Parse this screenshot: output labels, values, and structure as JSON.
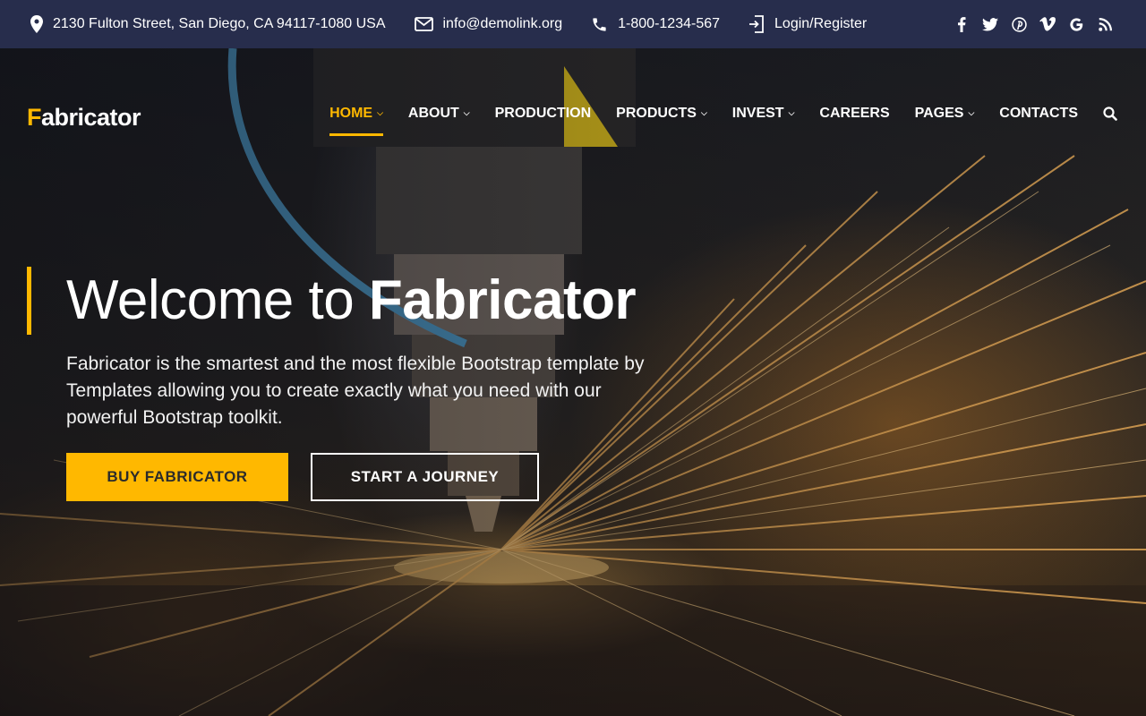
{
  "topbar": {
    "address": "2130 Fulton Street, San Diego, CA 94117-1080 USA",
    "email": "info@demolink.org",
    "phone": "1-800-1234-567",
    "login": "Login/Register",
    "socials": [
      "facebook-icon",
      "twitter-icon",
      "pinterest-icon",
      "vimeo-icon",
      "google-icon",
      "rss-icon"
    ]
  },
  "brand": {
    "logo_first": "F",
    "logo_rest": "abricator"
  },
  "nav": {
    "items": [
      {
        "label": "HOME",
        "active": true,
        "dropdown": true
      },
      {
        "label": "ABOUT",
        "dropdown": true
      },
      {
        "label": "PRODUCTION",
        "dropdown": false
      },
      {
        "label": "PRODUCTS",
        "dropdown": true
      },
      {
        "label": "INVEST",
        "dropdown": true
      },
      {
        "label": "CAREERS",
        "dropdown": false
      },
      {
        "label": "PAGES",
        "dropdown": true
      },
      {
        "label": "CONTACTS",
        "dropdown": false
      }
    ]
  },
  "hero": {
    "title_light": "Welcome to ",
    "title_bold": "Fabricator",
    "description": "Fabricator is the smartest and the most flexible Bootstrap template by Templates allowing you to create exactly what you need with our powerful Bootstrap toolkit.",
    "primary_button": "BUY FABRICATOR",
    "secondary_button": "START A JOURNEY"
  },
  "colors": {
    "accent": "#ffb800",
    "topbar_bg": "#272d4c"
  }
}
